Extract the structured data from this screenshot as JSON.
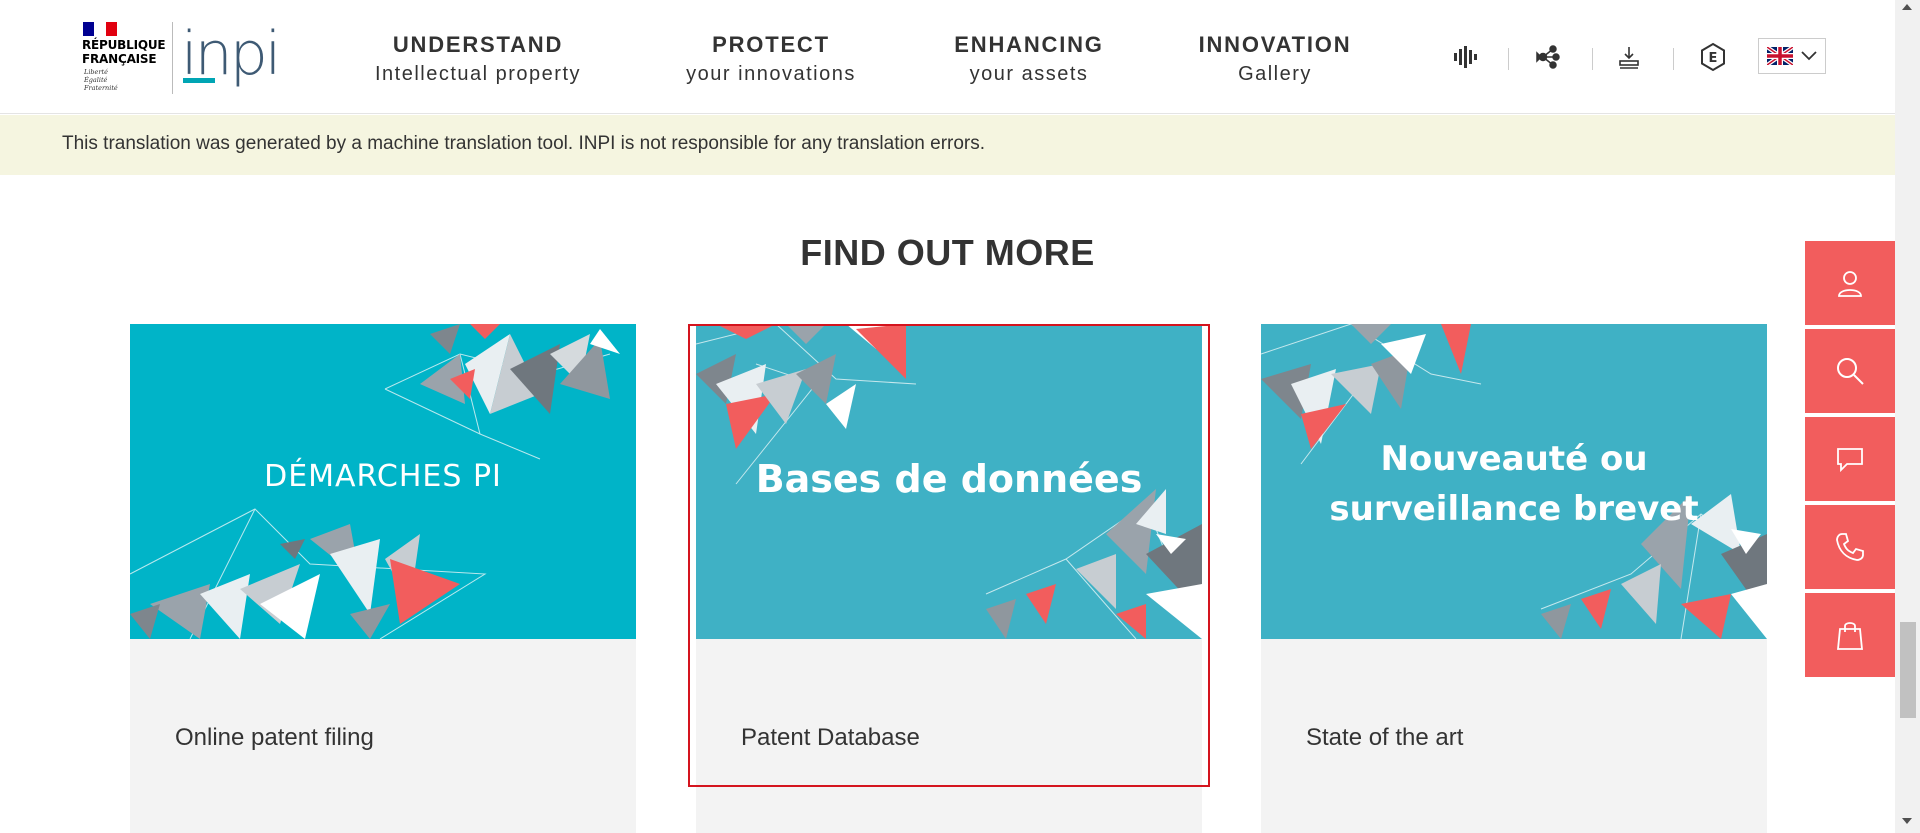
{
  "header": {
    "logo_rf": "RÉPUBLIQUE\nFRANÇAISE",
    "logo_motto": "Liberté\nÉgalité\nFraternité",
    "logo_inpi": "inpi",
    "nav": [
      {
        "line1": "UNDERSTAND",
        "line2": "Intellectual property"
      },
      {
        "line1": "PROTECT",
        "line2": "your innovations"
      },
      {
        "line1": "ENHANCING",
        "line2": "your assets"
      },
      {
        "line1": "INNOVATION",
        "line2": "Gallery"
      }
    ],
    "tools": [
      "audio-icon",
      "share-network-icon",
      "download-icon",
      "e-service-icon"
    ],
    "language_flag": "uk-flag-icon"
  },
  "banner": {
    "text": "This translation was generated by a machine translation tool. INPI is not responsible for any translation errors."
  },
  "section": {
    "title": "FIND OUT MORE"
  },
  "cards": [
    {
      "image_text": "DÉMARCHES PI",
      "caption": "Online patent filing"
    },
    {
      "image_text": "Bases de données",
      "caption": "Patent Database"
    },
    {
      "image_text_1": "Nouveauté ou",
      "image_text_2": "surveillance brevet",
      "caption": "State of the art"
    }
  ],
  "side_toolbar": [
    "user-icon",
    "search-icon",
    "chat-icon",
    "phone-icon",
    "shopping-bag-icon"
  ],
  "colors": {
    "teal": "#3fb1c5",
    "teal_bright": "#00b4c8",
    "coral": "#f25d5d",
    "banner_bg": "#f5f5e0",
    "highlight": "#d4141e"
  }
}
